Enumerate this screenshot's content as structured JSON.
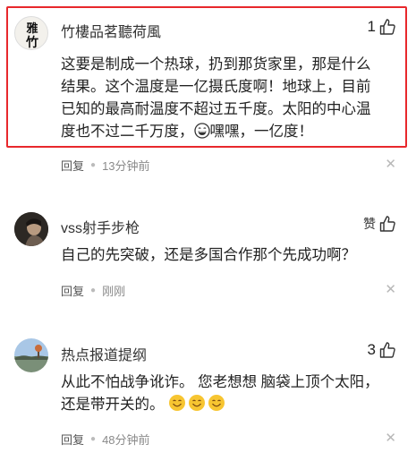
{
  "comments": [
    {
      "username": "竹樓品茗聽荷風",
      "avatar_chars": "雅竹",
      "like_count": "1",
      "lines": [
        "这要是制成一个热球，扔到那货家里，那是什么",
        "结果。这个温度是一亿摄氏度啊！地球上，目前",
        "已知的最高耐温度不超过五千度。太阳的中心温",
        "度也不过二千万度，"
      ],
      "tail": "嘿嘿，一亿度！",
      "reply_label": "回复",
      "time": "13分钟前",
      "highlighted": true
    },
    {
      "username": "vss射手步枪",
      "like_label": "赞",
      "lines": [
        "自己的先突破，还是多国合作那个先成功啊？"
      ],
      "reply_label": "回复",
      "time": "刚刚"
    },
    {
      "username": "热点报道提纲",
      "like_count": "3",
      "lines": [
        "从此不怕战争讹诈。 您老想想 脑袋上顶个太阳，",
        "还是带开关的。"
      ],
      "reply_label": "回复",
      "time": "48分钟前"
    }
  ],
  "icons": {
    "like": "thumbs-up-icon",
    "close": "close-icon",
    "emoji_grin": "grinning-face-icon",
    "emoji_smile": "smiling-face-icon"
  },
  "colors": {
    "highlight_border": "#e8282c",
    "meta_text": "#8a8a8a",
    "emoji_fill": "#f7c531"
  }
}
